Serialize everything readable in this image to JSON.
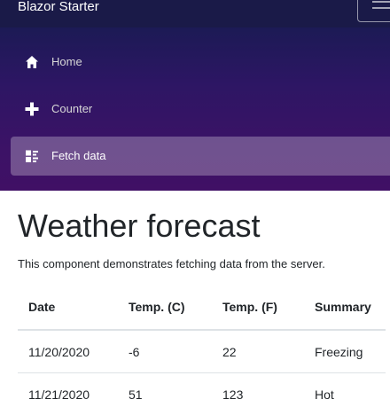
{
  "header": {
    "brand": "Blazor Starter"
  },
  "nav": {
    "items": [
      {
        "label": "Home",
        "icon": "home-icon",
        "active": false
      },
      {
        "label": "Counter",
        "icon": "plus-icon",
        "active": false
      },
      {
        "label": "Fetch data",
        "icon": "list-rich-icon",
        "active": true
      }
    ]
  },
  "page": {
    "title": "Weather forecast",
    "description": "This component demonstrates fetching data from the server."
  },
  "table": {
    "headers": [
      "Date",
      "Temp. (C)",
      "Temp. (F)",
      "Summary"
    ],
    "rows": [
      [
        "11/20/2020",
        "-6",
        "22",
        "Freezing"
      ],
      [
        "11/21/2020",
        "51",
        "123",
        "Hot"
      ]
    ]
  }
}
